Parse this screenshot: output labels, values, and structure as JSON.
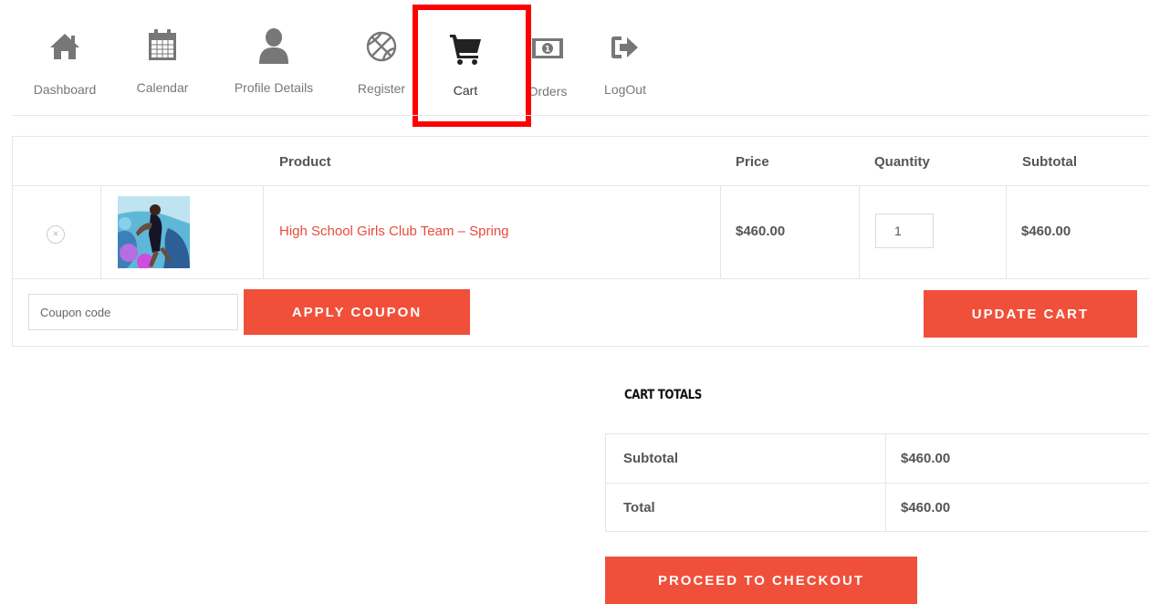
{
  "nav": {
    "items": [
      {
        "label": "Dashboard",
        "icon": "home-icon"
      },
      {
        "label": "Calendar",
        "icon": "calendar-icon"
      },
      {
        "label": "Profile Details",
        "icon": "user-icon"
      },
      {
        "label": "Register",
        "icon": "basketball-icon"
      },
      {
        "label": "Cart",
        "icon": "cart-icon"
      },
      {
        "label": "Orders",
        "icon": "money-icon"
      },
      {
        "label": "LogOut",
        "icon": "logout-icon"
      }
    ],
    "active": "Cart",
    "highlight_color": "#ff0000"
  },
  "cart": {
    "headers": {
      "product": "Product",
      "price": "Price",
      "quantity": "Quantity",
      "subtotal": "Subtotal"
    },
    "items": [
      {
        "remove_icon": "×",
        "name": "High School Girls Club Team – Spring",
        "price": "$460.00",
        "quantity": "1",
        "subtotal": "$460.00"
      }
    ],
    "coupon_placeholder": "Coupon code",
    "apply_coupon_label": "APPLY COUPON",
    "update_cart_label": "UPDATE CART"
  },
  "totals": {
    "title": "CART TOTALS",
    "subtotal_label": "Subtotal",
    "subtotal_value": "$460.00",
    "total_label": "Total",
    "total_value": "$460.00",
    "checkout_label": "PROCEED TO CHECKOUT"
  },
  "colors": {
    "accent": "#f0503a",
    "link": "#e94a3b",
    "icon": "#777777",
    "active_icon": "#222222"
  }
}
